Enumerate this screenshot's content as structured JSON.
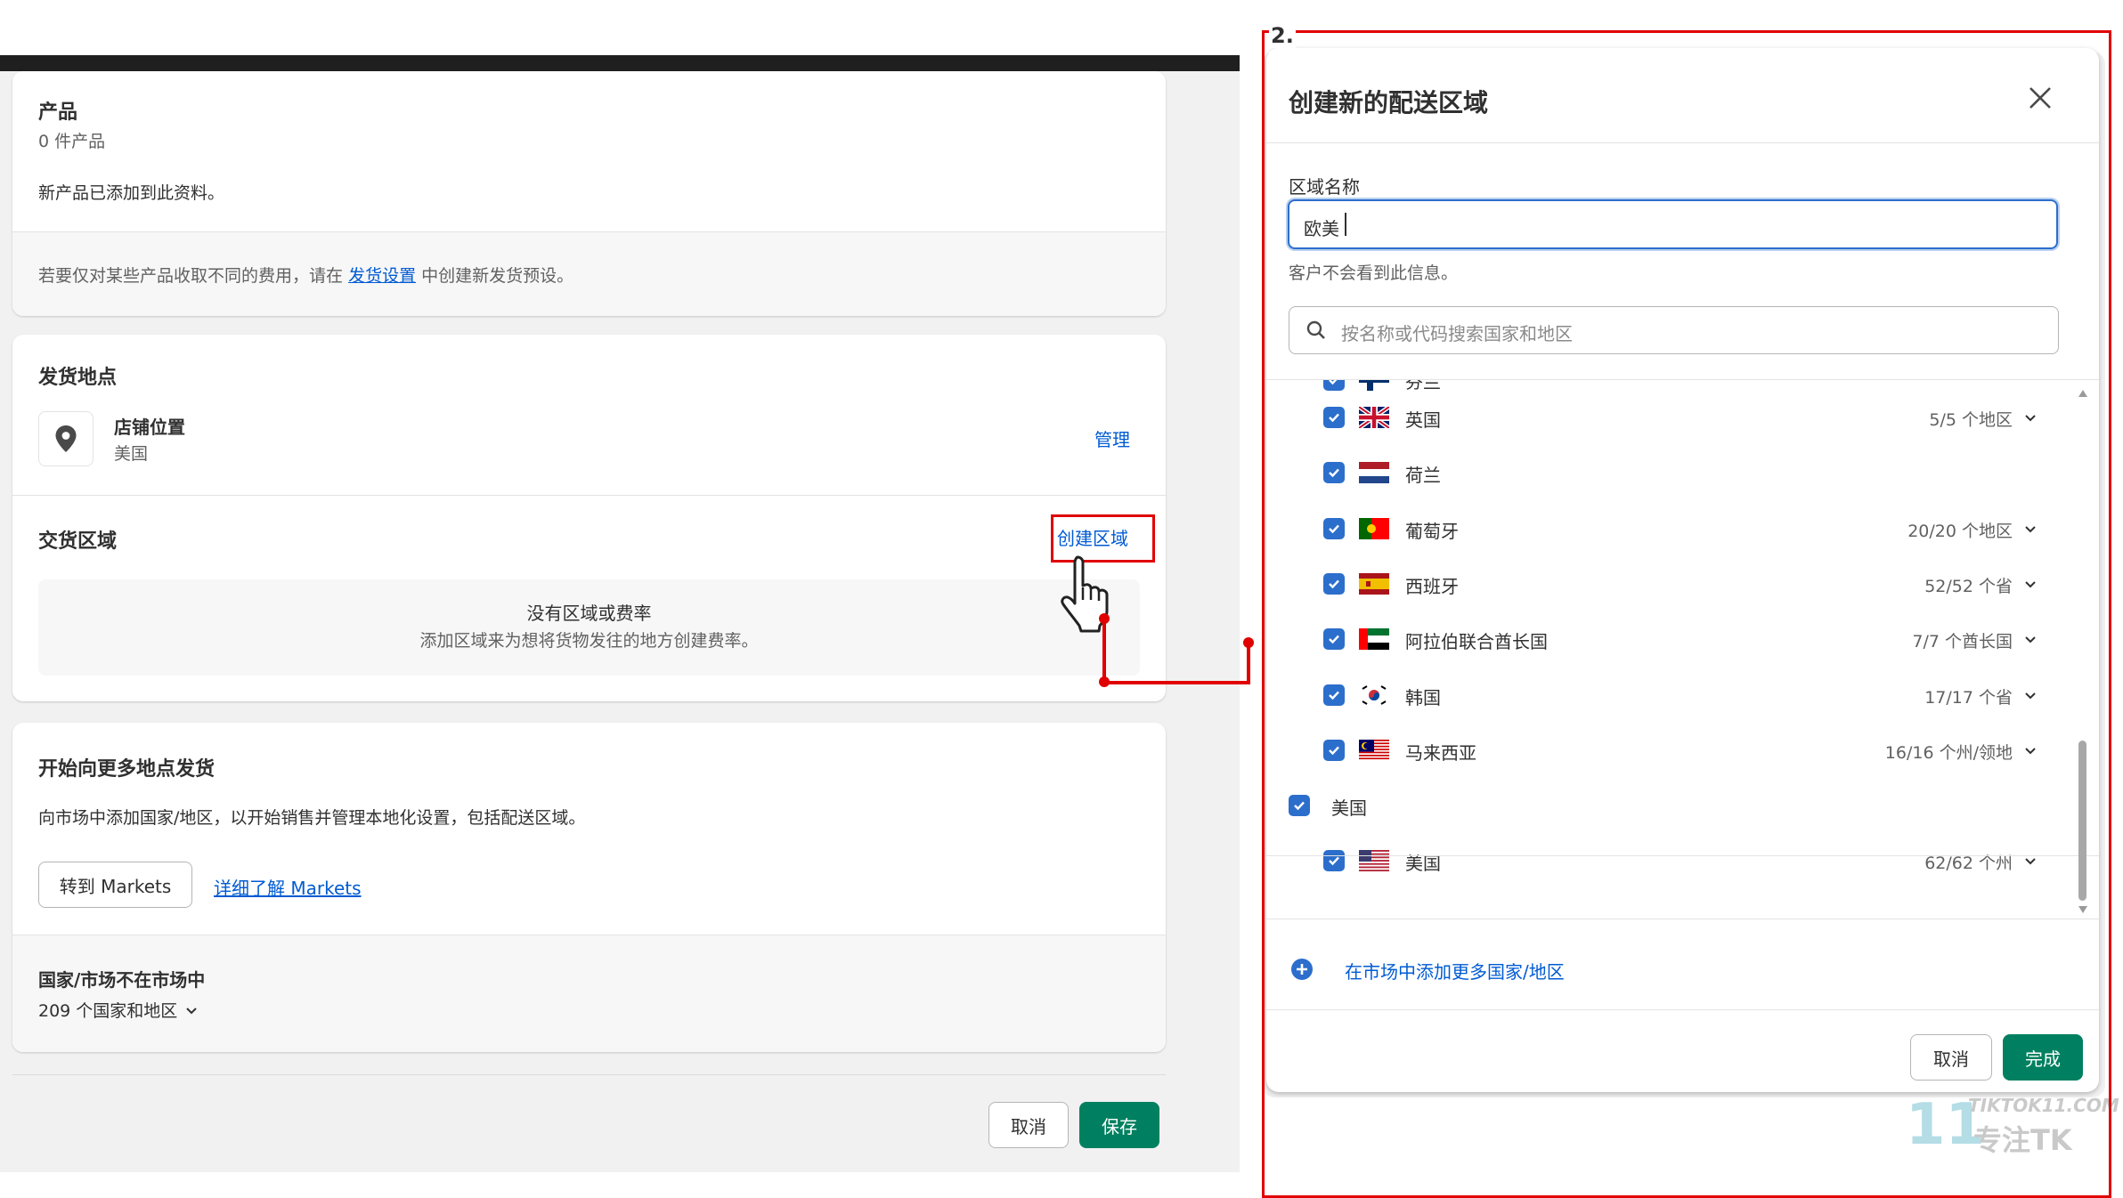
{
  "step_label": "2.",
  "products": {
    "title": "产品",
    "count": "0 件产品",
    "note": "新产品已添加到此资料。",
    "hint_before": "若要仅对某些产品收取不同的费用，请在",
    "hint_link": "发货设置",
    "hint_after": "中创建新发货预设。"
  },
  "origin": {
    "title": "发货地点",
    "store_name": "店铺位置",
    "store_country": "美国",
    "manage_label": "管理",
    "zones_title": "交货区域",
    "create_zone_label": "创建区域",
    "empty_title": "没有区域或费率",
    "empty_desc": "添加区域来为想将货物发往的地方创建费率。"
  },
  "markets": {
    "title": "开始向更多地点发货",
    "desc": "向市场中添加国家/地区，以开始销售并管理本地化设置，包括配送区域。",
    "goto_button": "转到 Markets",
    "learn_link": "详细了解 Markets",
    "not_in_title": "国家/市场不在市场中",
    "not_in_count": "209 个国家和地区"
  },
  "footer": {
    "cancel": "取消",
    "save": "保存"
  },
  "modal": {
    "title": "创建新的配送区域",
    "zone_name_label": "区域名称",
    "zone_name_value": "欧美",
    "zone_name_help": "客户不会看到此信息。",
    "search_placeholder": "按名称或代码搜索国家和地区",
    "partial_row": "芬兰",
    "countries": [
      {
        "name": "英国",
        "count": "5/5 个地区",
        "flag": "gb"
      },
      {
        "name": "荷兰",
        "count": "",
        "flag": "nl"
      },
      {
        "name": "葡萄牙",
        "count": "20/20 个地区",
        "flag": "pt"
      },
      {
        "name": "西班牙",
        "count": "52/52 个省",
        "flag": "es"
      },
      {
        "name": "阿拉伯联合酋长国",
        "count": "7/7 个酋长国",
        "flag": "ae"
      },
      {
        "name": "韩国",
        "count": "17/17 个省",
        "flag": "kr"
      },
      {
        "name": "马来西亚",
        "count": "16/16 个州/领地",
        "flag": "my"
      }
    ],
    "group_us": "美国",
    "us_row": {
      "name": "美国",
      "count": "62/62 个州",
      "flag": "us"
    },
    "add_more": "在市场中添加更多国家/地区",
    "cancel": "取消",
    "done": "完成"
  },
  "watermark": {
    "brand": "TIKTOK11.COM",
    "slogan": "专注TK",
    "number": "11"
  },
  "colors": {
    "accent_link": "#005bd3",
    "primary_green": "#008060",
    "checkbox_blue": "#2c6ecb",
    "annotation_red": "#e00000"
  }
}
